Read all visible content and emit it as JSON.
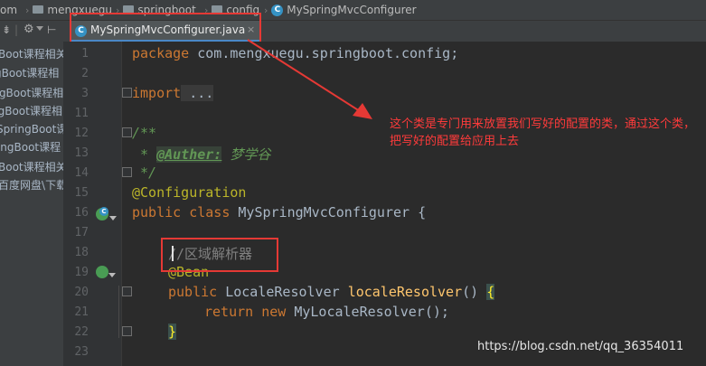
{
  "breadcrumbs": [
    "om",
    "mengxuegu",
    "springboot",
    "config",
    "MySpringMvcConfigurer"
  ],
  "tab": {
    "label": "MySpringMvcConfigurer.java",
    "close": "×"
  },
  "toolbar": {
    "split": "⇟",
    "gear": "⚙",
    "separator": "|"
  },
  "project_items": [
    "Boot课程相关",
    "gBoot课程相",
    "ingBoot课程相",
    "ngBoot课程相",
    "SpringBoot课",
    "ringBoot课程",
    "Boot课程相关",
    "\\百度网盘\\下载"
  ],
  "line_numbers": [
    "1",
    "2",
    "3",
    "11",
    "12",
    "13",
    "14",
    "15",
    "16",
    "17",
    "18",
    "19",
    "20",
    "21",
    "22",
    "23"
  ],
  "code": {
    "l1_kw": "package",
    "l1_rest": " com.mengxuegu.springboot.config;",
    "l3_kw": "import",
    "l3_rest": " ...",
    "l12": "/**",
    "l13_star": " * ",
    "l13_tag": "@Auther:",
    "l13_name": " 梦学谷",
    "l14": " */",
    "l15": "@Configuration",
    "l16_kw": "public class",
    "l16_rest": " MySpringMvcConfigurer {",
    "l18": "//区域解析器",
    "l19": "@Bean",
    "l20_kw": "public",
    "l20_type": " LocaleResolver ",
    "l20_fn": "localeResolver",
    "l20_rest": "() ",
    "l20_brace": "{",
    "l21_kw": "return new",
    "l21_rest": " MyLocaleResolver();",
    "l22": "}"
  },
  "annotation_note": "这个类是专门用来放置我们写好的配置的类，通过这个类，把写好的配置给应用上去",
  "watermark": "https://blog.csdn.net/qq_36354011",
  "colors": {
    "accent_red": "#e53935",
    "note_text": "#ff3b3b",
    "tab_underline": "#4a88c7"
  }
}
